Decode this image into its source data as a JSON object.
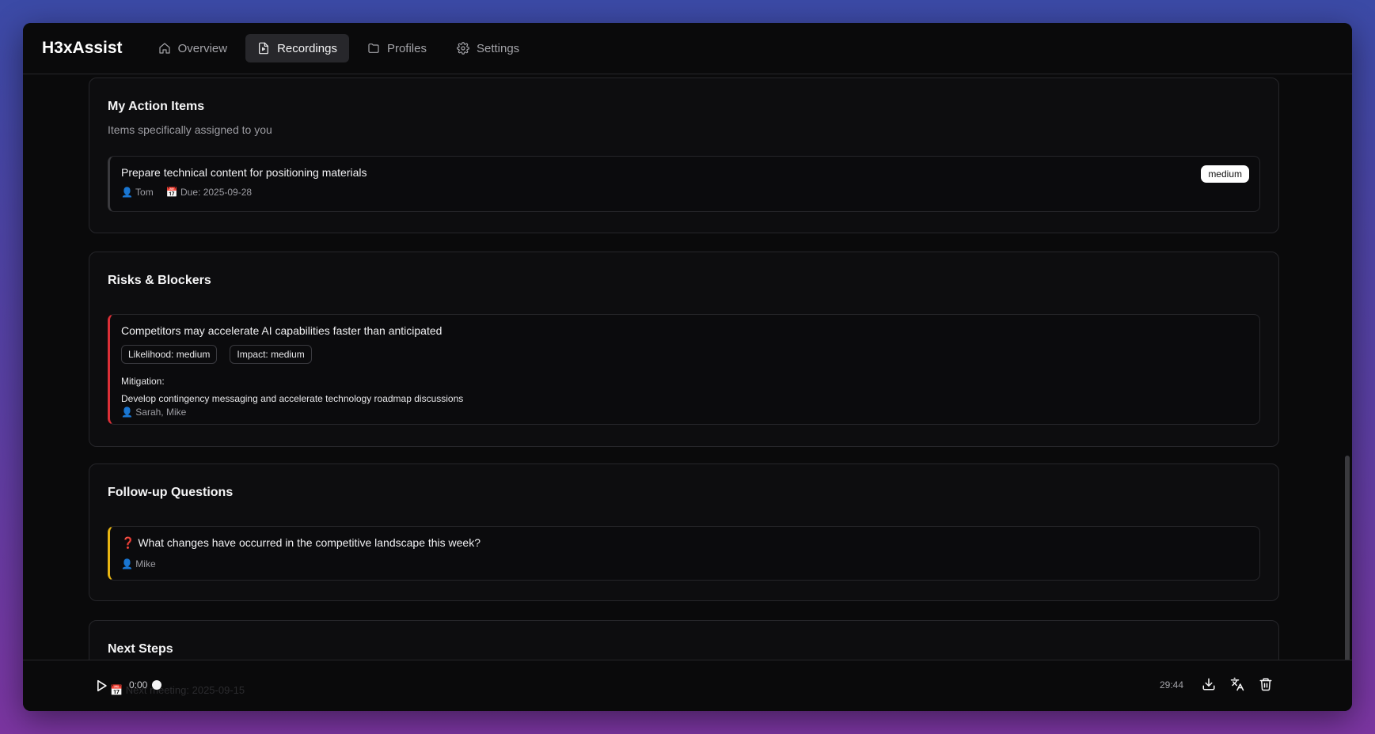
{
  "app": {
    "brand": "H3xAssist"
  },
  "nav": {
    "overview": "Overview",
    "recordings": "Recordings",
    "profiles": "Profiles",
    "settings": "Settings"
  },
  "action_items": {
    "title": "My Action Items",
    "description": "Items specifically assigned to you",
    "item": {
      "title": "Prepare technical content for positioning materials",
      "assignee": "👤 Tom",
      "due": "📅 Due: 2025-09-28",
      "priority": "medium"
    }
  },
  "risks": {
    "title": "Risks & Blockers",
    "item": {
      "title": "Competitors may accelerate AI capabilities faster than anticipated",
      "likelihood": "Likelihood: medium",
      "impact": "Impact: medium",
      "mitigation_label": "Mitigation:",
      "mitigation_text": "Develop contingency messaging and accelerate technology roadmap discussions",
      "owners": "👤 Sarah, Mike"
    }
  },
  "followup": {
    "title": "Follow-up Questions",
    "item": {
      "question": "❓ What changes have occurred in the competitive landscape this week?",
      "owner": "👤 Mike"
    }
  },
  "next_steps": {
    "title": "Next Steps",
    "obscured_text": "📅 Next meeting: 2025-09-15"
  },
  "player": {
    "current_time": "0:00",
    "total_time": "29:44",
    "progress": 0
  },
  "colors": {
    "risk_accent": "#dc2f37",
    "question_accent": "#e8b512",
    "background": "#0a0a0b"
  }
}
